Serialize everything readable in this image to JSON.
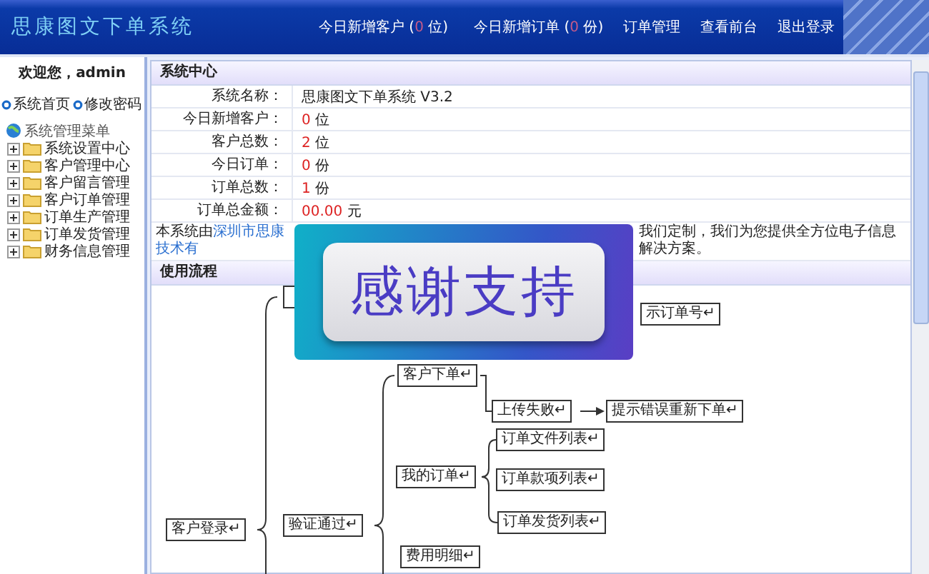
{
  "header": {
    "title": "思康图文下单系统",
    "nav": [
      {
        "kind": "count",
        "prefix": "今日新增客户 (",
        "count": "0",
        "suffix": " 位)"
      },
      {
        "kind": "count",
        "prefix": "今日新增订单 (",
        "count": "0",
        "suffix": " 份)"
      },
      {
        "kind": "link",
        "label": "订单管理"
      },
      {
        "kind": "link",
        "label": "查看前台"
      },
      {
        "kind": "link",
        "label": "退出登录"
      }
    ]
  },
  "sidebar": {
    "welcome": "欢迎您，admin",
    "links": [
      "系统首页",
      "修改密码"
    ],
    "menu_title": "系统管理菜单",
    "items": [
      {
        "label": "系统设置中心",
        "expanded": false
      },
      {
        "label": "客户管理中心",
        "expanded": false
      },
      {
        "label": "客户留言管理",
        "expanded": false
      },
      {
        "label": "客户订单管理",
        "expanded": false
      },
      {
        "label": "订单生产管理",
        "expanded": false
      },
      {
        "label": "订单发货管理",
        "expanded": false
      },
      {
        "label": "财务信息管理",
        "expanded": false
      }
    ]
  },
  "system_center": {
    "title": "系统中心",
    "rows": [
      {
        "label": "系统名称：",
        "value": "思康图文下单系统 V3.2"
      },
      {
        "label": "今日新增客户：",
        "count": "0",
        "unit": "位"
      },
      {
        "label": "客户总数：",
        "count": "2",
        "unit": "位"
      },
      {
        "label": "今日订单：",
        "count": "0",
        "unit": "份"
      },
      {
        "label": "订单总数：",
        "count": "1",
        "unit": "份"
      },
      {
        "label": "订单总金额：",
        "count": "00.00",
        "unit": "元"
      }
    ],
    "footer_prefix": "本系统由",
    "footer_link": "深圳市思康技术有",
    "footer_suffix": "我们定制，我们为您提供全方位电子信息解决方案。"
  },
  "flow": {
    "title": "使用流程",
    "nodes": [
      {
        "text": "示订单号↵"
      },
      {
        "text": "客户下单↵"
      },
      {
        "text": "上传失败↵"
      },
      {
        "text": "提示错误重新下单↵"
      },
      {
        "text": "订单文件列表↵"
      },
      {
        "text": "我的订单↵"
      },
      {
        "text": "订单款项列表↵"
      },
      {
        "text": "客户登录↵"
      },
      {
        "text": "验证通过↵"
      },
      {
        "text": "订单发货列表↵"
      },
      {
        "text": "费用明细↵"
      }
    ]
  },
  "banner": {
    "text": "感谢支持"
  }
}
